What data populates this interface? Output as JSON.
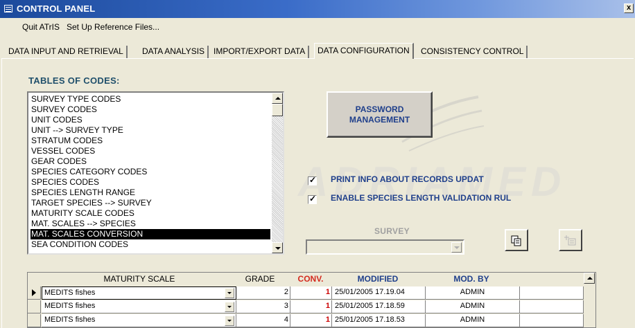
{
  "window": {
    "title": "CONTROL PANEL",
    "close_label": "x"
  },
  "menu": {
    "items": [
      "Quit ATrIS",
      "Set Up Reference Files..."
    ]
  },
  "tabs": [
    {
      "label": "DATA INPUT AND RETRIEVAL"
    },
    {
      "label": "DATA ANALYSIS"
    },
    {
      "label": "IMPORT/EXPORT DATA"
    },
    {
      "label": "DATA CONFIGURATION",
      "active": true
    },
    {
      "label": "CONSISTENCY CONTROL"
    }
  ],
  "codes": {
    "heading": "TABLES OF CODES:",
    "items": [
      "SURVEY TYPE CODES",
      "SURVEY CODES",
      "UNIT CODES",
      "UNIT --> SURVEY TYPE",
      "STRATUM CODES",
      "VESSEL CODES",
      "GEAR CODES",
      "SPECIES CATEGORY CODES",
      "SPECIES CODES",
      "SPECIES LENGTH RANGE",
      "TARGET SPECIES --> SURVEY",
      "MATURITY SCALE CODES",
      "MAT. SCALES --> SPECIES",
      "MAT. SCALES CONVERSION",
      "SEA CONDITION CODES"
    ],
    "selected_index": 13
  },
  "password_button": {
    "line1": "PASSWORD",
    "line2": "MANAGEMENT"
  },
  "watermark": "ADRIAMED",
  "options": {
    "print_info": {
      "label": "PRINT INFO ABOUT RECORDS UPDAT",
      "checked": true
    },
    "length_validation": {
      "label": "ENABLE SPECIES LENGTH VALIDATION RUL",
      "checked": true
    }
  },
  "survey": {
    "label": "SURVEY",
    "value": ""
  },
  "grid": {
    "columns": {
      "scale": "MATURITY SCALE",
      "grade": "GRADE",
      "conv": "CONV.",
      "modified": "MODIFIED",
      "modby": "MOD. BY"
    },
    "rows": [
      {
        "scale": "MEDITS fishes",
        "grade": "2",
        "conv": "1",
        "modified": "25/01/2005 17.19.04",
        "modby": "ADMIN",
        "current": true
      },
      {
        "scale": "MEDITS fishes",
        "grade": "3",
        "conv": "1",
        "modified": "25/01/2005 17.18.59",
        "modby": "ADMIN"
      },
      {
        "scale": "MEDITS fishes",
        "grade": "4",
        "conv": "1",
        "modified": "25/01/2005 17.18.53",
        "modby": "ADMIN"
      }
    ]
  },
  "colors": {
    "title_bar": "#1c4a9c",
    "accent_text": "#1f3f8b",
    "heading": "#1f4f6b",
    "conv_header": "#d42a1e",
    "conv_value": "#cc0000"
  }
}
